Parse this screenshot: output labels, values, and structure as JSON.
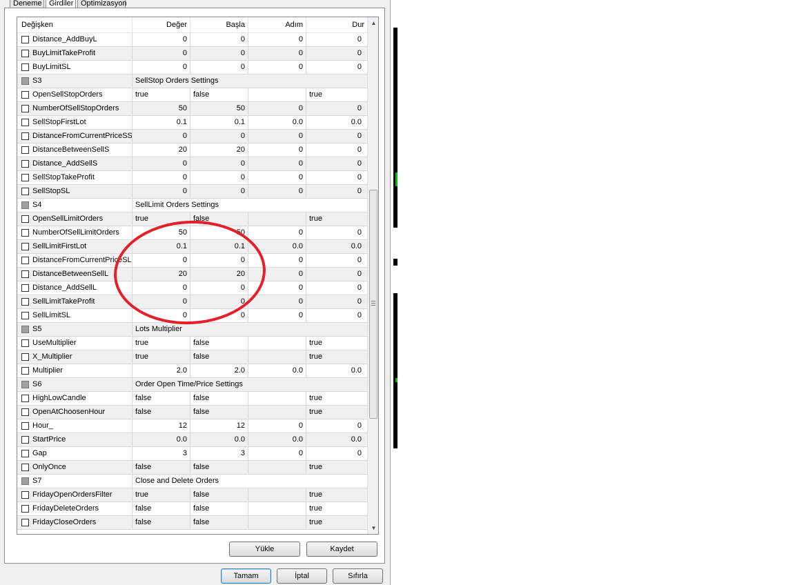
{
  "tabs": [
    {
      "label": "Deneme",
      "active": false
    },
    {
      "label": "Girdiler",
      "active": true
    },
    {
      "label": "Optimizasyon",
      "active": false
    }
  ],
  "columns": {
    "name": "Değişken",
    "value": "Değer",
    "start": "Başla",
    "step": "Adım",
    "stop": "Dur"
  },
  "rows": [
    {
      "type": "param",
      "name": "Distance_AddBuyL",
      "value": "0",
      "start": "0",
      "step": "0",
      "stop": "0",
      "align": "num"
    },
    {
      "type": "param",
      "name": "BuyLimitTakeProfit",
      "value": "0",
      "start": "0",
      "step": "0",
      "stop": "0",
      "align": "num"
    },
    {
      "type": "param",
      "name": "BuyLimitSL",
      "value": "0",
      "start": "0",
      "step": "0",
      "stop": "0",
      "align": "num"
    },
    {
      "type": "section",
      "name": "S3",
      "label": "SellStop Orders Settings"
    },
    {
      "type": "param",
      "name": "OpenSellStopOrders",
      "value": "true",
      "start": "false",
      "step": "",
      "stop": "true",
      "align": "text"
    },
    {
      "type": "param",
      "name": "NumberOfSellStopOrders",
      "value": "50",
      "start": "50",
      "step": "0",
      "stop": "0",
      "align": "num"
    },
    {
      "type": "param",
      "name": "SellStopFirstLot",
      "value": "0.1",
      "start": "0.1",
      "step": "0.0",
      "stop": "0.0",
      "align": "num"
    },
    {
      "type": "param",
      "name": "DistanceFromCurrentPriceSS",
      "value": "0",
      "start": "0",
      "step": "0",
      "stop": "0",
      "align": "num"
    },
    {
      "type": "param",
      "name": "DistanceBetweenSellS",
      "value": "20",
      "start": "20",
      "step": "0",
      "stop": "0",
      "align": "num"
    },
    {
      "type": "param",
      "name": "Distance_AddSellS",
      "value": "0",
      "start": "0",
      "step": "0",
      "stop": "0",
      "align": "num"
    },
    {
      "type": "param",
      "name": "SellStopTakeProfit",
      "value": "0",
      "start": "0",
      "step": "0",
      "stop": "0",
      "align": "num"
    },
    {
      "type": "param",
      "name": "SellStopSL",
      "value": "0",
      "start": "0",
      "step": "0",
      "stop": "0",
      "align": "num"
    },
    {
      "type": "section",
      "name": "S4",
      "label": "SellLimit Orders Settings"
    },
    {
      "type": "param",
      "name": "OpenSellLimitOrders",
      "value": "true",
      "start": "false",
      "step": "",
      "stop": "true",
      "align": "text"
    },
    {
      "type": "param",
      "name": "NumberOfSellLimitOrders",
      "value": "50",
      "start": "50",
      "step": "0",
      "stop": "0",
      "align": "num"
    },
    {
      "type": "param",
      "name": "SellLimitFirstLot",
      "value": "0.1",
      "start": "0.1",
      "step": "0.0",
      "stop": "0.0",
      "align": "num"
    },
    {
      "type": "param",
      "name": "DistanceFromCurrentPriceSL",
      "value": "0",
      "start": "0",
      "step": "0",
      "stop": "0",
      "align": "num"
    },
    {
      "type": "param",
      "name": "DistanceBetweenSellL",
      "value": "20",
      "start": "20",
      "step": "0",
      "stop": "0",
      "align": "num"
    },
    {
      "type": "param",
      "name": "Distance_AddSellL",
      "value": "0",
      "start": "0",
      "step": "0",
      "stop": "0",
      "align": "num"
    },
    {
      "type": "param",
      "name": "SellLimitTakeProfit",
      "value": "0",
      "start": "0",
      "step": "0",
      "stop": "0",
      "align": "num"
    },
    {
      "type": "param",
      "name": "SellLimitSL",
      "value": "0",
      "start": "0",
      "step": "0",
      "stop": "0",
      "align": "num"
    },
    {
      "type": "section",
      "name": "S5",
      "label": "Lots Multiplier"
    },
    {
      "type": "param",
      "name": "UseMultiplier",
      "value": "true",
      "start": "false",
      "step": "",
      "stop": "true",
      "align": "text"
    },
    {
      "type": "param",
      "name": "X_Multiplier",
      "value": "true",
      "start": "false",
      "step": "",
      "stop": "true",
      "align": "text"
    },
    {
      "type": "param",
      "name": "Multiplier",
      "value": "2.0",
      "start": "2.0",
      "step": "0.0",
      "stop": "0.0",
      "align": "num"
    },
    {
      "type": "section",
      "name": "S6",
      "label": "Order Open Time/Price Settings"
    },
    {
      "type": "param",
      "name": "HighLowCandle",
      "value": "false",
      "start": "false",
      "step": "",
      "stop": "true",
      "align": "text"
    },
    {
      "type": "param",
      "name": "OpenAtChoosenHour",
      "value": "false",
      "start": "false",
      "step": "",
      "stop": "true",
      "align": "text"
    },
    {
      "type": "param",
      "name": "Hour_",
      "value": "12",
      "start": "12",
      "step": "0",
      "stop": "0",
      "align": "num"
    },
    {
      "type": "param",
      "name": "StartPrice",
      "value": "0.0",
      "start": "0.0",
      "step": "0.0",
      "stop": "0.0",
      "align": "num"
    },
    {
      "type": "param",
      "name": "Gap",
      "value": "3",
      "start": "3",
      "step": "0",
      "stop": "0",
      "align": "num"
    },
    {
      "type": "param",
      "name": "OnlyOnce",
      "value": "false",
      "start": "false",
      "step": "",
      "stop": "true",
      "align": "text"
    },
    {
      "type": "section",
      "name": "S7",
      "label": "Close and Delete Orders"
    },
    {
      "type": "param",
      "name": "FridayOpenOrdersFilter",
      "value": "true",
      "start": "false",
      "step": "",
      "stop": "true",
      "align": "text"
    },
    {
      "type": "param",
      "name": "FridayDeleteOrders",
      "value": "false",
      "start": "false",
      "step": "",
      "stop": "true",
      "align": "text"
    },
    {
      "type": "param",
      "name": "FridayCloseOrders",
      "value": "false",
      "start": "false",
      "step": "",
      "stop": "true",
      "align": "text"
    }
  ],
  "buttons": {
    "load": "Yükle",
    "save": "Kaydet",
    "ok": "Tamam",
    "cancel": "İptal",
    "reset": "Sıfırla"
  },
  "annotation_color": "#e3202b"
}
